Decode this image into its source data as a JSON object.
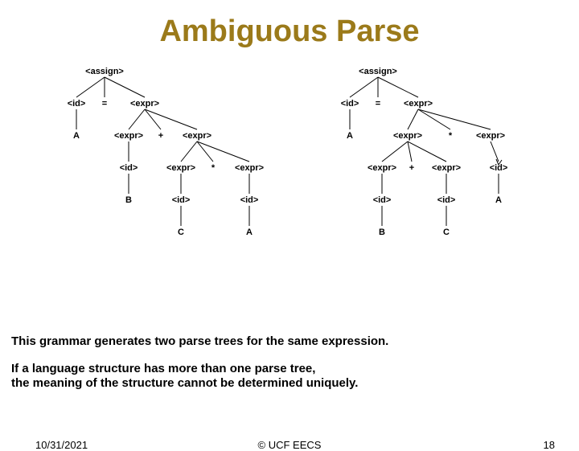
{
  "title": "Ambiguous Parse",
  "left_tree": {
    "assign": "<assign>",
    "id1": "<id>",
    "eq": "=",
    "expr1": "<expr>",
    "A1": "A",
    "expr2": "<expr>",
    "plus": "+",
    "expr3": "<expr>",
    "id2": "<id>",
    "expr4": "<expr>",
    "star": "*",
    "expr5": "<expr>",
    "B": "B",
    "id3": "<id>",
    "id4": "<id>",
    "C": "C",
    "A2": "A"
  },
  "right_tree": {
    "assign": "<assign>",
    "id1": "<id>",
    "eq": "=",
    "expr1": "<expr>",
    "A1": "A",
    "expr2": "<expr>",
    "star": "*",
    "expr3": "<expr>",
    "expr4": "<expr>",
    "plus": "+",
    "expr5": "<expr>",
    "id2": "<id>",
    "id3": "<id>",
    "id4": "<id>",
    "A2": "A",
    "B": "B",
    "C": "C"
  },
  "text1": "This grammar generates two parse trees  for the same expression.",
  "text2": "If a language structure has more than one parse tree,",
  "text3": "the meaning of the structure cannot be determined uniquely.",
  "footer": {
    "date": "10/31/2021",
    "copyright": "© UCF EECS",
    "page": "18"
  }
}
